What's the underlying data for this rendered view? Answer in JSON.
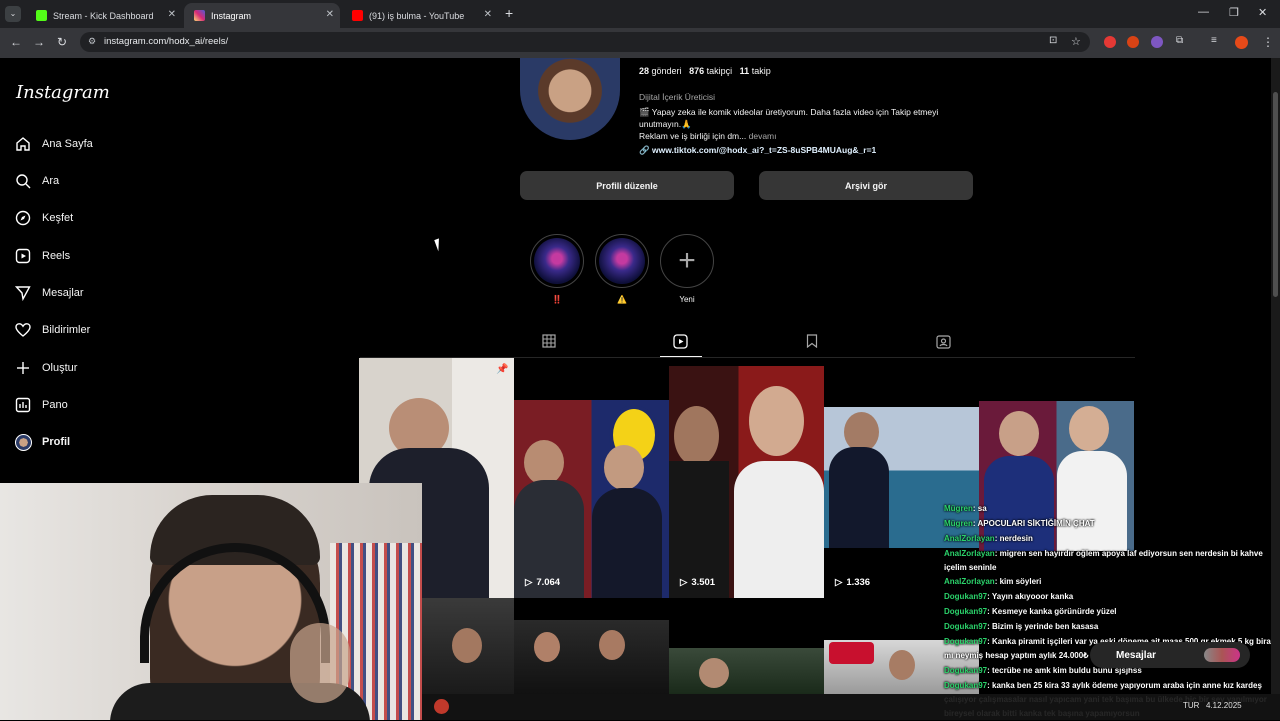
{
  "browser": {
    "tabs": [
      {
        "label": "Stream - Kick Dashboard",
        "favicon_color": "#53fc18"
      },
      {
        "label": "Instagram",
        "favicon_color": "#e1306c"
      },
      {
        "label": "(91) iş bulma - YouTube",
        "favicon_color": "#ff0000"
      }
    ],
    "url": "instagram.com/hodx_ai/reels/"
  },
  "sidebar": {
    "logo": "Instagram",
    "items": [
      {
        "label": "Ana Sayfa",
        "icon": "home-icon"
      },
      {
        "label": "Ara",
        "icon": "search-icon"
      },
      {
        "label": "Keşfet",
        "icon": "compass-icon"
      },
      {
        "label": "Reels",
        "icon": "reels-icon"
      },
      {
        "label": "Mesajlar",
        "icon": "send-icon"
      },
      {
        "label": "Bildirimler",
        "icon": "heart-icon"
      },
      {
        "label": "Oluştur",
        "icon": "plus-icon"
      },
      {
        "label": "Pano",
        "icon": "chart-icon"
      },
      {
        "label": "Profil",
        "icon": "avatar-icon"
      }
    ]
  },
  "profile": {
    "posts_count": "28",
    "posts_label": "gönderi",
    "followers_count": "876",
    "followers_label": "takipçi",
    "following_count": "11",
    "following_label": "takip",
    "category": "Dijital İçerik Üreticisi",
    "bio_line1": "🎬 Yapay zeka ile komik videolar üretiyorum. Daha fazla video için Takip etmeyi unutmayın.🙏",
    "bio_line2": "Reklam ve iş birliği için dm...",
    "bio_more": "devamı",
    "link": "www.tiktok.com/@hodx_ai?_t=ZS-8uSPB4MUAug&_r=1",
    "edit_button": "Profili düzenle",
    "archive_button": "Arşivi gör"
  },
  "highlights": [
    {
      "label": "‼️"
    },
    {
      "label": "⚠️"
    },
    {
      "label": "Yeni"
    }
  ],
  "reels": [
    {
      "views": ""
    },
    {
      "views": "7.064"
    },
    {
      "views": "3.501"
    },
    {
      "views": "1.336"
    }
  ],
  "chat": {
    "messages": [
      {
        "user": "Mügren",
        "text": ": sa"
      },
      {
        "user": "Mügren",
        "text": ": APOCULARI SİKTİĞİMİN ÇHAT"
      },
      {
        "user": "AnalZorlayan",
        "text": ": nerdesin"
      },
      {
        "user": "AnalZorlayan",
        "text": ": migren sen hayırdır oğlem apoya laf ediyorsun sen nerdesin bi kahve içelim seninle"
      },
      {
        "user": "AnalZorlayan",
        "text": ": kim söyleri"
      },
      {
        "user": "Dogukan97",
        "text": ": Yayın akıyooor kanka"
      },
      {
        "user": "Dogukan97",
        "text": ": Kesmeye kanka görünürde yüzel"
      },
      {
        "user": "Dogukan97",
        "text": ": Bizim iş yerinde ben kasasa"
      },
      {
        "user": "Dogukan97",
        "text": ": Kanka piramit işçileri var ya eski döneme ait maaş 500 gr ekmek 5 kg bira mı neymiş hesap yaptım aylık 24.000₺ maaş alıyorlar"
      },
      {
        "user": "Dogukan97",
        "text": ": tecrübe ne amk kim buldu bunu sjsjhss"
      },
      {
        "user": "Dogukan97",
        "text": ": kanka ben 25 kira 33 aylık ödeme yapıyorum araba için anne kız kardeş çalışıyor çalışmasalar nasıl yapıcam yani tek başıma bu ülkede hiç bir şey yapılmıyor bireysel olarak bitti kanka tek başına yapamıyorsun"
      }
    ],
    "messages_button": "Mesajlar"
  },
  "taskbar": {
    "lang": "TUR",
    "date": "4.12.2025"
  }
}
